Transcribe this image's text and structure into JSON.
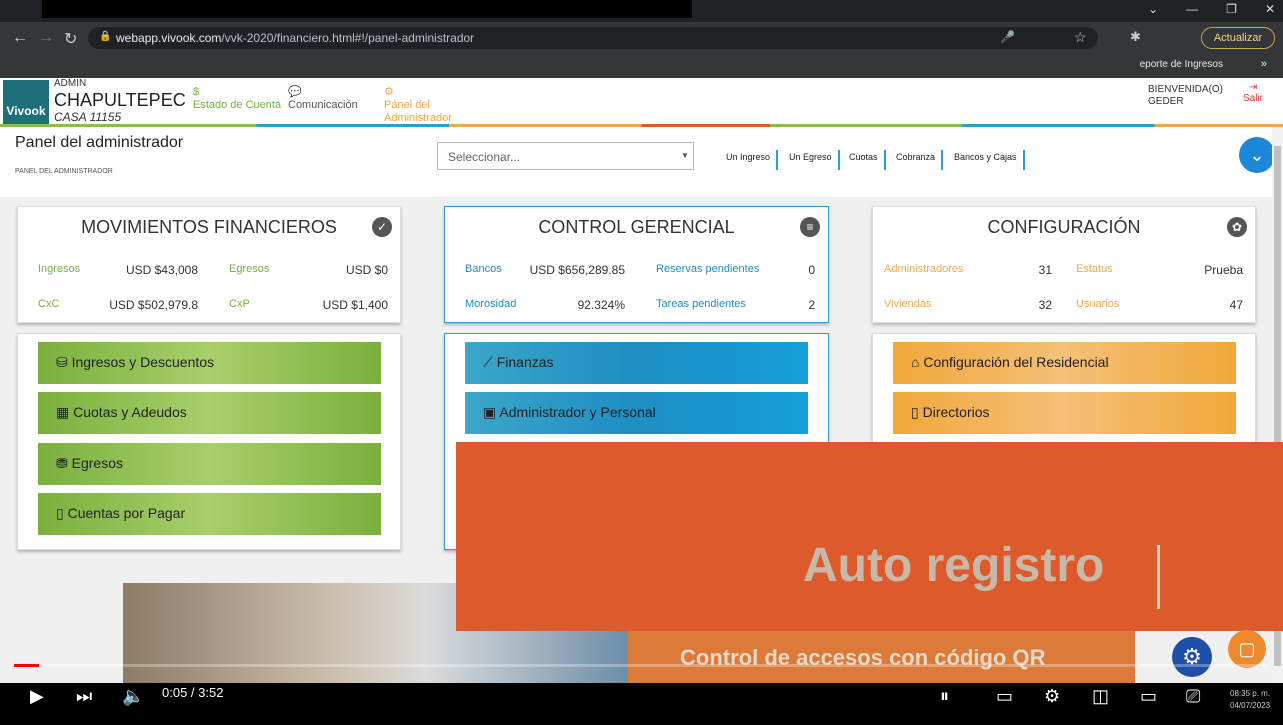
{
  "browser": {
    "url_domain": "webapp.vivook.com",
    "url_path": "/vvk-2020/financiero.html#!/panel-administrador",
    "update_label": "Actualizar",
    "bookmark": "eporte de Ingresos",
    "bookmark_more": "»"
  },
  "app": {
    "logo_text": "Vivook",
    "admin_label": "ADMIN",
    "establishment": "CHAPULTEPEC",
    "house": "CASA 11155",
    "nav": [
      {
        "label": "Estado de Cuenta",
        "icon": "dollar-circle-icon"
      },
      {
        "label": "Comunicación",
        "icon": "chat-bubbles-icon"
      },
      {
        "label": "Pánel del Administrador",
        "icon": "network-icon"
      }
    ],
    "welcome_line1": "BIENVENIDA(O)",
    "welcome_line2": "GEDER",
    "logout_label": "Salir",
    "page_title": "Panel del administrador",
    "breadcrumb": "PANEL DEL ADMINISTRADOR",
    "select_placeholder": "Seleccionar...",
    "quick_links": [
      "Un Ingreso",
      "Un Egreso",
      "Cuotas",
      "Cobranza",
      "Bancos y Cajas"
    ]
  },
  "cards": {
    "financial": {
      "title": "MOVIMIENTOS FINANCIEROS",
      "items": [
        {
          "label": "Ingresos",
          "value": "USD $43,008"
        },
        {
          "label": "Egresos",
          "value": "USD $0"
        },
        {
          "label": "CxC",
          "value": "USD $502,979.8"
        },
        {
          "label": "CxP",
          "value": "USD $1,400"
        }
      ]
    },
    "control": {
      "title": "CONTROL GERENCIAL",
      "items": [
        {
          "label": "Bancos",
          "value": "USD $656,289.85"
        },
        {
          "label": "Reservas pendientes",
          "value": "0"
        },
        {
          "label": "Morosidad",
          "value": "92.324%"
        },
        {
          "label": "Tareas pendientes",
          "value": "2"
        }
      ]
    },
    "config": {
      "title": "CONFIGURACIÓN",
      "items": [
        {
          "label": "Administradores",
          "value": "31"
        },
        {
          "label": "Estatus",
          "value": "Prueba"
        },
        {
          "label": "Viviendas",
          "value": "32"
        },
        {
          "label": "Usuarios",
          "value": "47"
        }
      ]
    }
  },
  "buttons": {
    "green": [
      "Ingresos y Descuentos",
      "Cuotas y Adeudos",
      "Egresos",
      "Cuentas por Pagar"
    ],
    "blue": [
      "Finanzas",
      "Administrador y Personal"
    ],
    "orange": [
      "Configuración del Residencial",
      "Directorios"
    ]
  },
  "overlay": {
    "headline": "Auto registro",
    "subline": "Control de accesos con código QR"
  },
  "player": {
    "time": "0:05 / 3:52",
    "progress": 0.02,
    "clock_time": "08:35 p. m.",
    "clock_date": "04/07/2023"
  },
  "colors": {
    "green": "#8bbf44",
    "blue": "#2aa0cf",
    "orange": "#f0a84a",
    "banner": "#dc5a2c"
  }
}
